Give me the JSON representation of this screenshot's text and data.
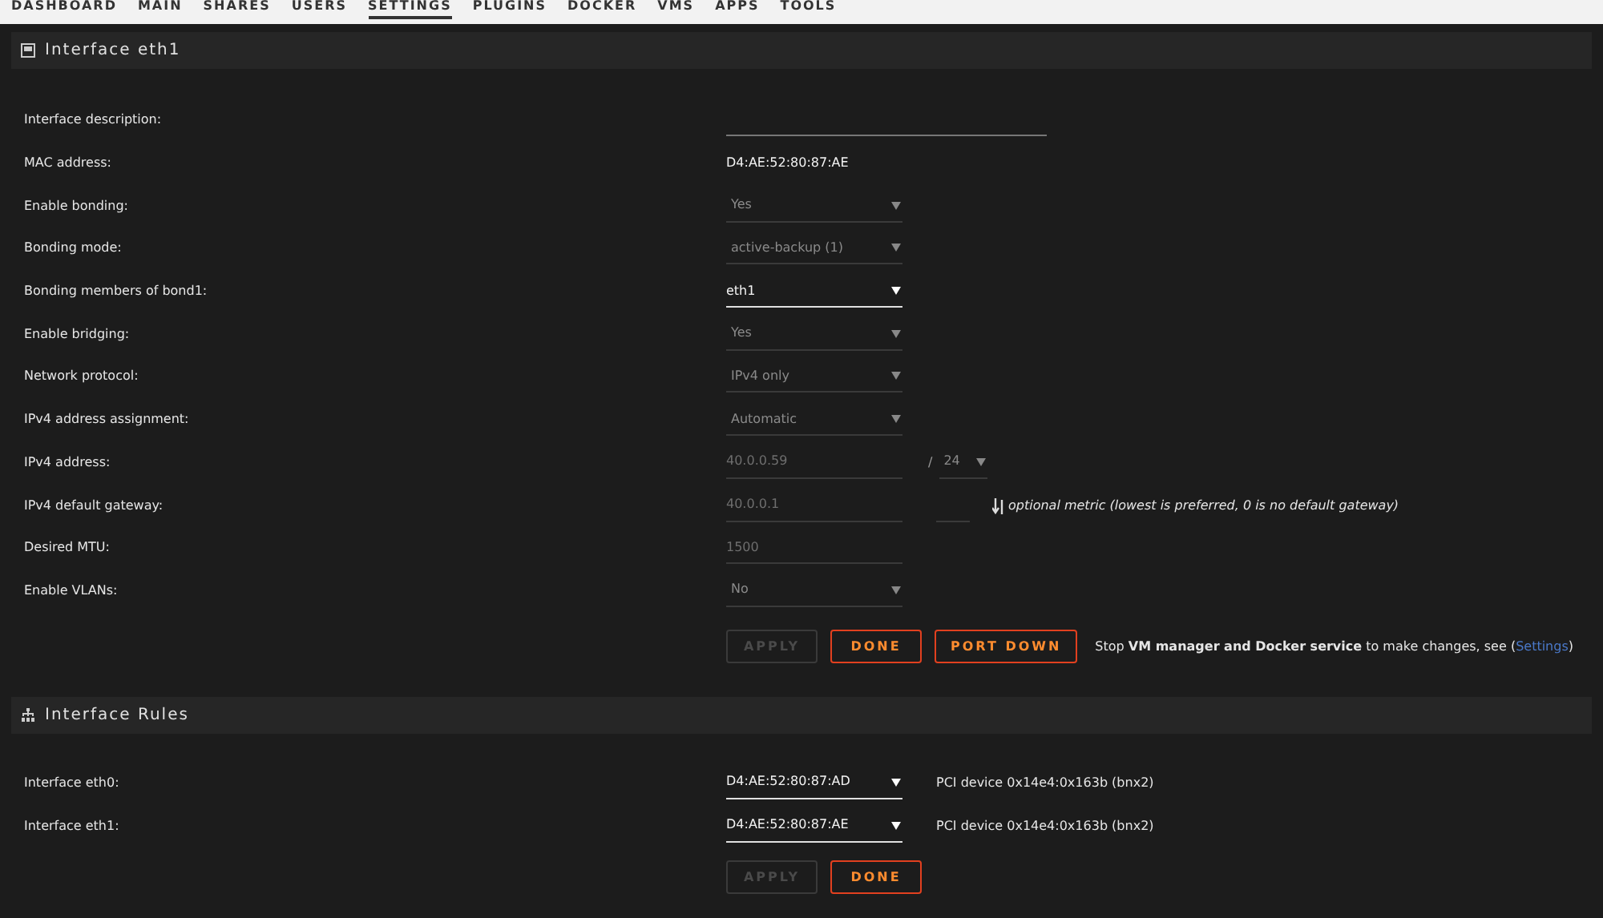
{
  "nav": [
    {
      "label": "DASHBOARD",
      "selected": false
    },
    {
      "label": "MAIN",
      "selected": false
    },
    {
      "label": "SHARES",
      "selected": false
    },
    {
      "label": "USERS",
      "selected": false
    },
    {
      "label": "SETTINGS",
      "selected": true
    },
    {
      "label": "PLUGINS",
      "selected": false
    },
    {
      "label": "DOCKER",
      "selected": false
    },
    {
      "label": "VMS",
      "selected": false
    },
    {
      "label": "APPS",
      "selected": false
    },
    {
      "label": "TOOLS",
      "selected": false
    }
  ],
  "interface": {
    "title": "Interface eth1",
    "rows": [
      {
        "label": "Interface description:",
        "kind": "text",
        "disabled": false
      },
      {
        "label": "MAC address:",
        "kind": "static",
        "value": "D4:AE:52:80:87:AE"
      },
      {
        "label": "Enable bonding:",
        "kind": "select",
        "value": "Yes",
        "disabled": true
      },
      {
        "label": "Bonding mode:",
        "kind": "select",
        "value": "active-backup (1)",
        "disabled": true
      },
      {
        "label": "Bonding members of bond1:",
        "kind": "select",
        "value": "eth1",
        "disabled": false
      },
      {
        "label": "Enable bridging:",
        "kind": "select",
        "value": "Yes",
        "disabled": true
      },
      {
        "label": "Network protocol:",
        "kind": "select",
        "value": "IPv4 only",
        "disabled": true
      },
      {
        "label": "IPv4 address assignment:",
        "kind": "select",
        "value": "Automatic",
        "disabled": true
      },
      {
        "label": "IPv4 address:",
        "kind": "address",
        "value": "40.0.0.59",
        "separator": "/",
        "prefix": "24",
        "disabled": true
      },
      {
        "label": "IPv4 default gateway:",
        "kind": "gateway",
        "value": "40.0.0.1",
        "note": "optional metric (lowest is preferred, 0 is no default gateway)",
        "disabled": true
      },
      {
        "label": "Desired MTU:",
        "kind": "text",
        "value": "1500",
        "disabled": true
      },
      {
        "label": "Enable VLANs:",
        "kind": "select",
        "value": "No",
        "disabled": true
      }
    ],
    "buttons": [
      {
        "label": "APPLY",
        "disabled": true
      },
      {
        "label": "DONE",
        "disabled": false
      },
      {
        "label": "PORT DOWN",
        "disabled": false
      }
    ],
    "note": {
      "text": "Stop **VM manager and Docker service** to make changes, see (",
      "link": "Settings",
      "after": ")"
    }
  },
  "rules": {
    "title": "Interface Rules",
    "rows": [
      {
        "label": "Interface eth0:",
        "value": "D4:AE:52:80:87:AD",
        "info": "PCI device 0x14e4:0x163b (bnx2)"
      },
      {
        "label": "Interface eth1:",
        "value": "D4:AE:52:80:87:AE",
        "info": "PCI device 0x14e4:0x163b (bnx2)"
      }
    ],
    "buttons": [
      {
        "label": "APPLY",
        "disabled": true
      },
      {
        "label": "DONE",
        "disabled": false
      }
    ]
  }
}
